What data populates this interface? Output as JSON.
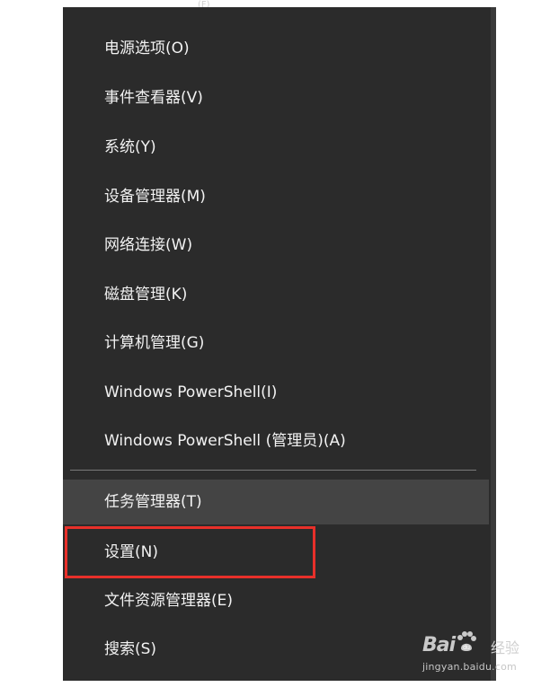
{
  "menu": {
    "cut_item_label": "(F)",
    "items": [
      {
        "label": "电源选项(O)"
      },
      {
        "label": "事件查看器(V)"
      },
      {
        "label": "系统(Y)"
      },
      {
        "label": "设备管理器(M)"
      },
      {
        "label": "网络连接(W)"
      },
      {
        "label": "磁盘管理(K)"
      },
      {
        "label": "计算机管理(G)"
      },
      {
        "label": "Windows PowerShell(I)"
      },
      {
        "label": "Windows PowerShell (管理员)(A)"
      },
      {
        "label": "任务管理器(T)"
      },
      {
        "label": "设置(N)"
      },
      {
        "label": "文件资源管理器(E)"
      },
      {
        "label": "搜索(S)"
      }
    ]
  },
  "highlight": {
    "target": "设置(N)",
    "color": "#e8302a"
  },
  "watermark": {
    "logo_text": "Bai",
    "logo_suffix": "经验",
    "url": "jingyan.baidu.com"
  },
  "colors": {
    "menu_bg": "#2b2b2b",
    "hover_bg": "#444444",
    "text": "#f2f2f2",
    "separator": "#7a7a7a"
  }
}
